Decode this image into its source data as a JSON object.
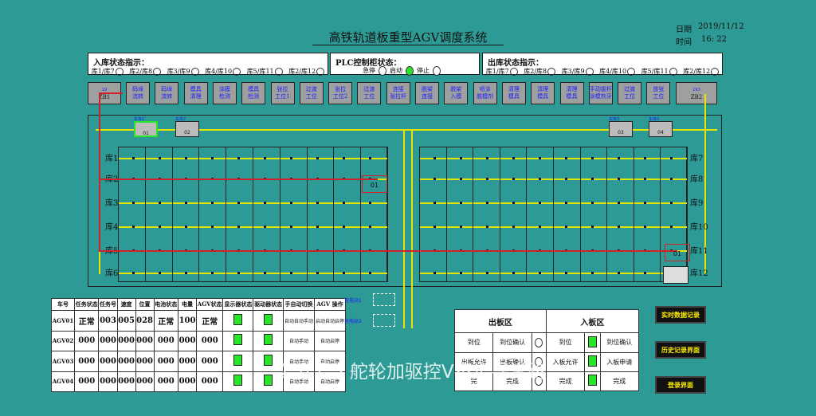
{
  "header": {
    "title": "高铁轨道板重型AGV调度系统",
    "date_label": "日期",
    "date_value": "2019/11/12",
    "time_label": "时间",
    "time_value": "16: 22"
  },
  "inbound_status": {
    "title": "入库状态指示：",
    "items": [
      "库1/库7",
      "库2/库8",
      "库3/库9",
      "库4/库10",
      "库5/库11",
      "库2/库12"
    ]
  },
  "plc_status": {
    "title": "PLC控制柜状态：",
    "items": [
      {
        "label": "急停",
        "on": false
      },
      {
        "label": "启动",
        "on": true
      },
      {
        "label": "停止",
        "on": false
      }
    ]
  },
  "outbound_status": {
    "title": "出库状态指示：",
    "items": [
      "库1/库7",
      "库2/库8",
      "库3/库9",
      "库4/库10",
      "库5/库11",
      "库2/库12"
    ]
  },
  "workstations": [
    "码垛\n流转",
    "码垛\n流转",
    "模具\n清理",
    "涂膜\n检测",
    "模具\n检测",
    "张拉\n工位1",
    "过渡\n工位",
    "张拉\n工位2",
    "过渡\n工位",
    "连接\n张拉杆",
    "脱架\n连接",
    "脱架\n入模",
    "喷涂\n脱模剂",
    "清理\n模具",
    "清理\n模具",
    "清理\n模具",
    "手动拔杆\n涂模剂牙",
    "过渡\n工位",
    "放张\n工位"
  ],
  "left_zone": {
    "node": "19",
    "label": "ZB1"
  },
  "right_zone": {
    "node": "193",
    "label": "ZB2"
  },
  "store_labels_left": [
    "库1",
    "库2",
    "库3",
    "库4",
    "库5",
    "库6"
  ],
  "store_labels_right": [
    "库7",
    "库8",
    "库9",
    "库10",
    "库11",
    "库12"
  ],
  "cars": [
    {
      "label": "车库1",
      "id": "01"
    },
    {
      "label": "车库2",
      "id": "02"
    },
    {
      "label": "车库3",
      "id": "03"
    },
    {
      "label": "车库4",
      "id": "04"
    }
  ],
  "agv_markers": [
    "01",
    "01"
  ],
  "charge_labels": [
    "充电站1",
    "充电站2"
  ],
  "table": {
    "headers": [
      "车号",
      "任务状态",
      "任务号",
      "速度",
      "位置",
      "电池状态",
      "电量",
      "AGV状态",
      "显示器状态",
      "驱动器状态",
      "手自动切换",
      "AGV 操作"
    ],
    "rows": [
      {
        "id": "AGV01",
        "task_state": "正常",
        "task_no": "003",
        "speed": "005",
        "pos": "028",
        "bat_state": "正常",
        "charge": "100",
        "agv_state": "正常",
        "disp": true,
        "drv": true,
        "mode": "自动",
        "mode_btn": "自动手动",
        "op": "启动",
        "op_btn": "自动启停"
      },
      {
        "id": "AGV02",
        "task_state": "000",
        "task_no": "000",
        "speed": "000",
        "pos": "000",
        "bat_state": "000",
        "charge": "000",
        "agv_state": "000",
        "disp": true,
        "drv": true,
        "mode": "",
        "mode_btn": "自动手动",
        "op": "",
        "op_btn": "自动启停"
      },
      {
        "id": "AGV03",
        "task_state": "000",
        "task_no": "000",
        "speed": "000",
        "pos": "000",
        "bat_state": "000",
        "charge": "000",
        "agv_state": "000",
        "disp": true,
        "drv": true,
        "mode": "",
        "mode_btn": "自动手动",
        "op": "",
        "op_btn": "自动启停"
      },
      {
        "id": "AGV04",
        "task_state": "000",
        "task_no": "000",
        "speed": "000",
        "pos": "000",
        "bat_state": "000",
        "charge": "000",
        "agv_state": "000",
        "disp": true,
        "drv": true,
        "mode": "",
        "mode_btn": "自动手动",
        "op": "",
        "op_btn": "自动启停"
      }
    ]
  },
  "boards": {
    "out_title": "出板区",
    "in_title": "入板区",
    "out_rows": [
      {
        "a": "到",
        "b": "位",
        "c": "到位确认"
      },
      {
        "a": "出板允许",
        "b": "",
        "c": "出板确认"
      },
      {
        "a": "完",
        "b": "",
        "c": "完成"
      }
    ],
    "in_rows": [
      {
        "a": "到",
        "b": "位",
        "c": "到位确认"
      },
      {
        "a": "入板允许",
        "b": "",
        "c": "入板申请"
      },
      {
        "a": "完成",
        "b": "",
        "c": "完成"
      }
    ]
  },
  "buttons": {
    "realtime": "实时数据记录",
    "history": "历史记录界面",
    "login": "登录界面"
  },
  "watermark": "公众号 · 舵轮加驱控V不走寻常路",
  "colors": {
    "bg": "#2e9a96",
    "track": "#e6e600",
    "route": "#d0202a",
    "led_on": "#2ae42a"
  }
}
